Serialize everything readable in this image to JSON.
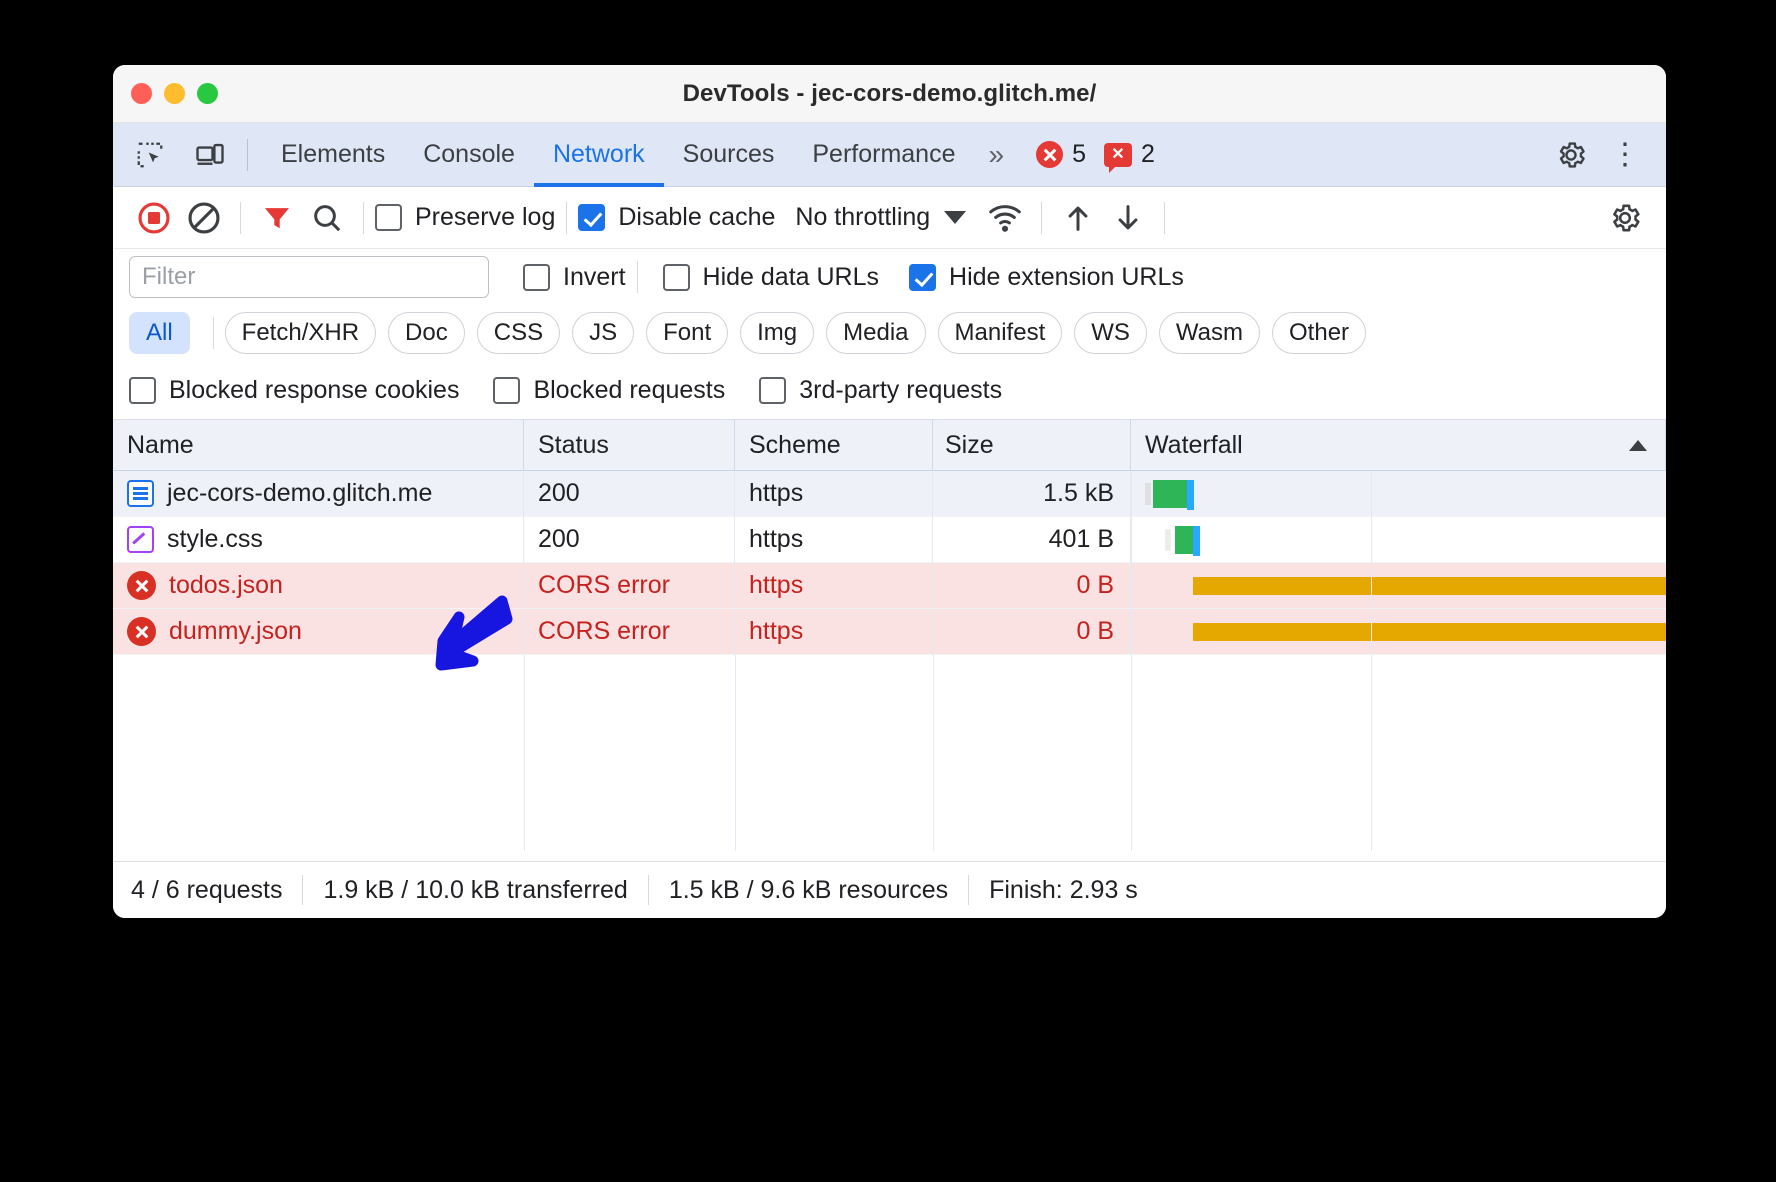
{
  "window": {
    "title": "DevTools - jec-cors-demo.glitch.me/",
    "traffic_lights": [
      "close",
      "minimize",
      "zoom"
    ]
  },
  "tabstrip": {
    "icons": [
      "inspect-element-icon",
      "device-toolbar-icon"
    ],
    "tabs": [
      {
        "label": "Elements",
        "active": false
      },
      {
        "label": "Console",
        "active": false
      },
      {
        "label": "Network",
        "active": true
      },
      {
        "label": "Sources",
        "active": false
      },
      {
        "label": "Performance",
        "active": false
      }
    ],
    "more_tabs": "»",
    "error_count": "5",
    "warning_count": "2",
    "settings_icon": "gear-icon",
    "menu_icon": "kebab-menu-icon"
  },
  "network_toolbar": {
    "record_icon": "record-stop-icon",
    "clear_icon": "clear-icon",
    "filter_icon": "filter-funnel-icon",
    "search_icon": "search-icon",
    "preserve_log": {
      "label": "Preserve log",
      "checked": false
    },
    "disable_cache": {
      "label": "Disable cache",
      "checked": true
    },
    "throttling": {
      "value": "No throttling"
    },
    "wifi_icon": "network-conditions-icon",
    "import_icon": "import-har-icon",
    "export_icon": "export-har-icon",
    "settings_icon": "network-settings-gear-icon"
  },
  "filter_row": {
    "input_placeholder": "Filter",
    "input_value": "",
    "invert": {
      "label": "Invert",
      "checked": false
    },
    "hide_data_urls": {
      "label": "Hide data URLs",
      "checked": false
    },
    "hide_extension_urls": {
      "label": "Hide extension URLs",
      "checked": true
    }
  },
  "type_chips": [
    {
      "label": "All",
      "selected": true
    },
    {
      "label": "Fetch/XHR",
      "selected": false
    },
    {
      "label": "Doc",
      "selected": false
    },
    {
      "label": "CSS",
      "selected": false
    },
    {
      "label": "JS",
      "selected": false
    },
    {
      "label": "Font",
      "selected": false
    },
    {
      "label": "Img",
      "selected": false
    },
    {
      "label": "Media",
      "selected": false
    },
    {
      "label": "Manifest",
      "selected": false
    },
    {
      "label": "WS",
      "selected": false
    },
    {
      "label": "Wasm",
      "selected": false
    },
    {
      "label": "Other",
      "selected": false
    }
  ],
  "blocked_row": [
    {
      "label": "Blocked response cookies",
      "checked": false
    },
    {
      "label": "Blocked requests",
      "checked": false
    },
    {
      "label": "3rd-party requests",
      "checked": false
    }
  ],
  "table": {
    "columns": [
      "Name",
      "Status",
      "Scheme",
      "Size",
      "Waterfall"
    ],
    "sorted_column": "Waterfall",
    "sort_direction": "ascending",
    "rows": [
      {
        "icon": "document-file-icon",
        "name": "jec-cors-demo.glitch.me",
        "status": "200",
        "scheme": "https",
        "size": "1.5 kB",
        "error": false
      },
      {
        "icon": "stylesheet-file-icon",
        "name": "style.css",
        "status": "200",
        "scheme": "https",
        "size": "401 B",
        "error": false
      },
      {
        "icon": "error-circle-icon",
        "name": "todos.json",
        "status": "CORS error",
        "scheme": "https",
        "size": "0 B",
        "error": true
      },
      {
        "icon": "error-circle-icon",
        "name": "dummy.json",
        "status": "CORS error",
        "scheme": "https",
        "size": "0 B",
        "error": true
      }
    ]
  },
  "summary": {
    "requests": "4 / 6 requests",
    "transferred": "1.9 kB / 10.0 kB transferred",
    "resources": "1.5 kB / 9.6 kB resources",
    "finish": "Finish: 2.93 s"
  },
  "annotation": {
    "type": "arrow",
    "color": "#1616e0",
    "points_to": "todos.json"
  },
  "colors": {
    "accent_blue": "#1a73e8",
    "error_red": "#c5221f",
    "error_row_bg": "#fbe2e2",
    "waterfall_green": "#2db557",
    "waterfall_orange": "#e5a800",
    "waterfall_blue": "#29a8ff"
  }
}
